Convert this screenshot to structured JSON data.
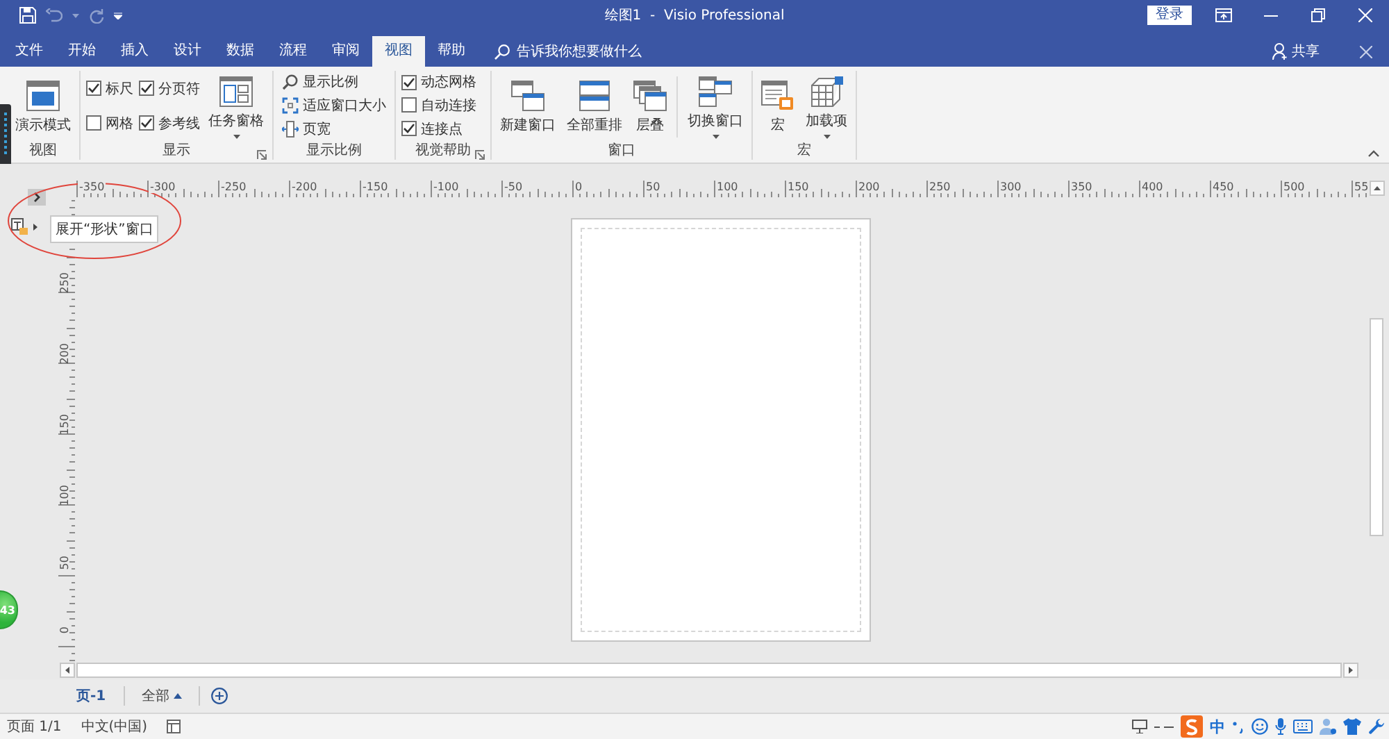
{
  "window": {
    "title": "绘图1  -  Visio Professional",
    "sign_in": "登录"
  },
  "tabs": [
    {
      "label": "文件",
      "selected": false
    },
    {
      "label": "开始",
      "selected": false
    },
    {
      "label": "插入",
      "selected": false
    },
    {
      "label": "设计",
      "selected": false
    },
    {
      "label": "数据",
      "selected": false
    },
    {
      "label": "流程",
      "selected": false
    },
    {
      "label": "审阅",
      "selected": false
    },
    {
      "label": "视图",
      "selected": true
    },
    {
      "label": "帮助",
      "selected": false
    }
  ],
  "tell_me": {
    "placeholder": "告诉我你想要做什么"
  },
  "share": {
    "label": "共享"
  },
  "ribbon": {
    "groups": [
      {
        "label": "视图",
        "columns": [
          [
            {
              "kind": "large",
              "label": "演示模式"
            }
          ]
        ]
      },
      {
        "label": "显示",
        "launcher": true,
        "columns": [
          [
            {
              "kind": "check",
              "label": "标尺",
              "checked": true
            },
            {
              "kind": "check",
              "label": "网格",
              "checked": false
            }
          ],
          [
            {
              "kind": "check",
              "label": "分页符",
              "checked": true
            },
            {
              "kind": "check",
              "label": "参考线",
              "checked": true
            }
          ],
          [
            {
              "kind": "large",
              "label": "任务窗格",
              "dropdown": true
            }
          ]
        ]
      },
      {
        "label": "显示比例",
        "columns": [
          [
            {
              "kind": "small",
              "label": "显示比例"
            },
            {
              "kind": "small",
              "label": "适应窗口大小"
            },
            {
              "kind": "small",
              "label": "页宽"
            }
          ]
        ]
      },
      {
        "label": "视觉帮助",
        "launcher": true,
        "columns": [
          [
            {
              "kind": "check",
              "label": "动态网格",
              "checked": true
            },
            {
              "kind": "check",
              "label": "自动连接",
              "checked": false
            },
            {
              "kind": "check",
              "label": "连接点",
              "checked": true
            }
          ]
        ]
      },
      {
        "label": "窗口",
        "columns": [
          [
            {
              "kind": "large",
              "label": "新建窗口"
            }
          ],
          [
            {
              "kind": "large",
              "label": "全部重排"
            }
          ],
          [
            {
              "kind": "large",
              "label": "层叠"
            }
          ],
          [
            {
              "kind": "divider"
            }
          ],
          [
            {
              "kind": "large",
              "label": "切换窗口",
              "dropdown": true
            }
          ]
        ]
      },
      {
        "label": "宏",
        "columns": [
          [
            {
              "kind": "large",
              "label": "宏"
            }
          ],
          [
            {
              "kind": "large",
              "label": "加载项",
              "dropdown": true
            }
          ]
        ]
      }
    ]
  },
  "shapes_pane": {
    "tooltip": "展开“形状”窗口"
  },
  "rulers": {
    "horizontal": [
      "-350",
      "-300",
      "-250",
      "-200",
      "-150",
      "-100",
      "-50",
      "0",
      "50",
      "100",
      "150",
      "200",
      "250",
      "300",
      "350",
      "400",
      "450",
      "500",
      "55"
    ],
    "vertical": [
      "250",
      "200",
      "150",
      "100",
      "50",
      "0"
    ]
  },
  "floating_badge": "43",
  "page_tabs": {
    "pages": [
      {
        "label": "页-1",
        "selected": true
      }
    ],
    "all_pages": "全部"
  },
  "status_bar": {
    "page": "页面 1/1",
    "language": "中文(中国)",
    "ime_mode": "中"
  }
}
